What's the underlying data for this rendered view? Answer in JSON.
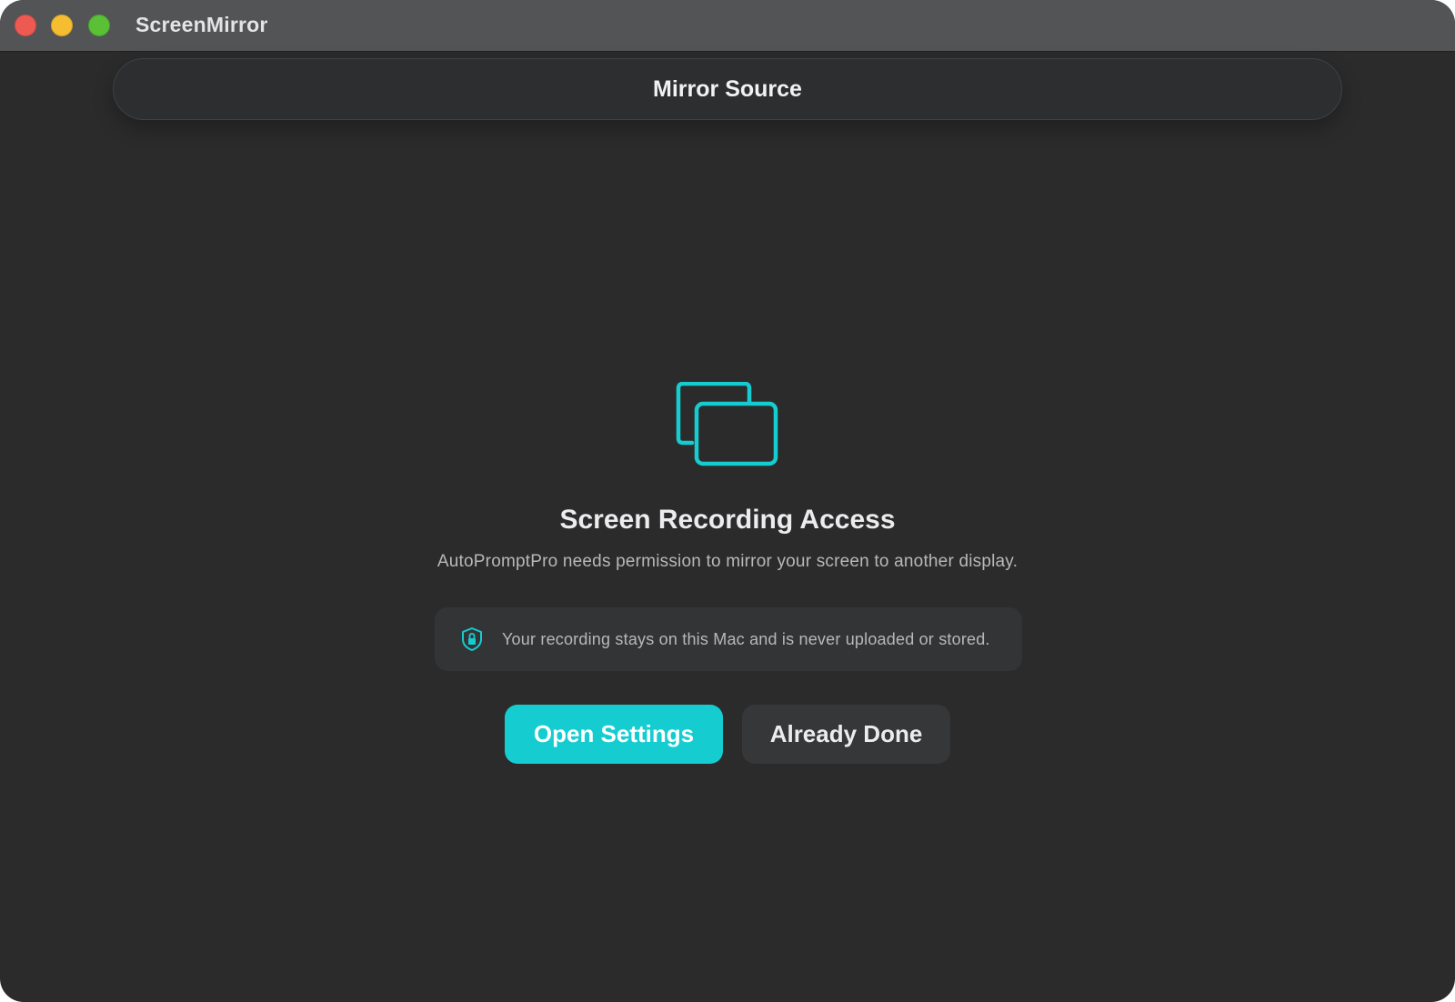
{
  "window": {
    "app_title": "ScreenMirror",
    "controls": [
      "close",
      "minimize",
      "zoom"
    ]
  },
  "header": {
    "title": "Mirror Source"
  },
  "permission": {
    "icon": "screens-icon",
    "heading": "Screen Recording Access",
    "description": "AutoPromptPro needs permission to mirror your screen to another display.",
    "notice": {
      "icon": "shield-lock-icon",
      "text": "Your recording stays on this Mac and is never uploaded or stored."
    }
  },
  "actions": {
    "primary_label": "Open Settings",
    "secondary_label": "Already Done"
  },
  "colors": {
    "accent": "#15cdd0",
    "background": "#2b2b2c",
    "titlebar": "#535456"
  }
}
